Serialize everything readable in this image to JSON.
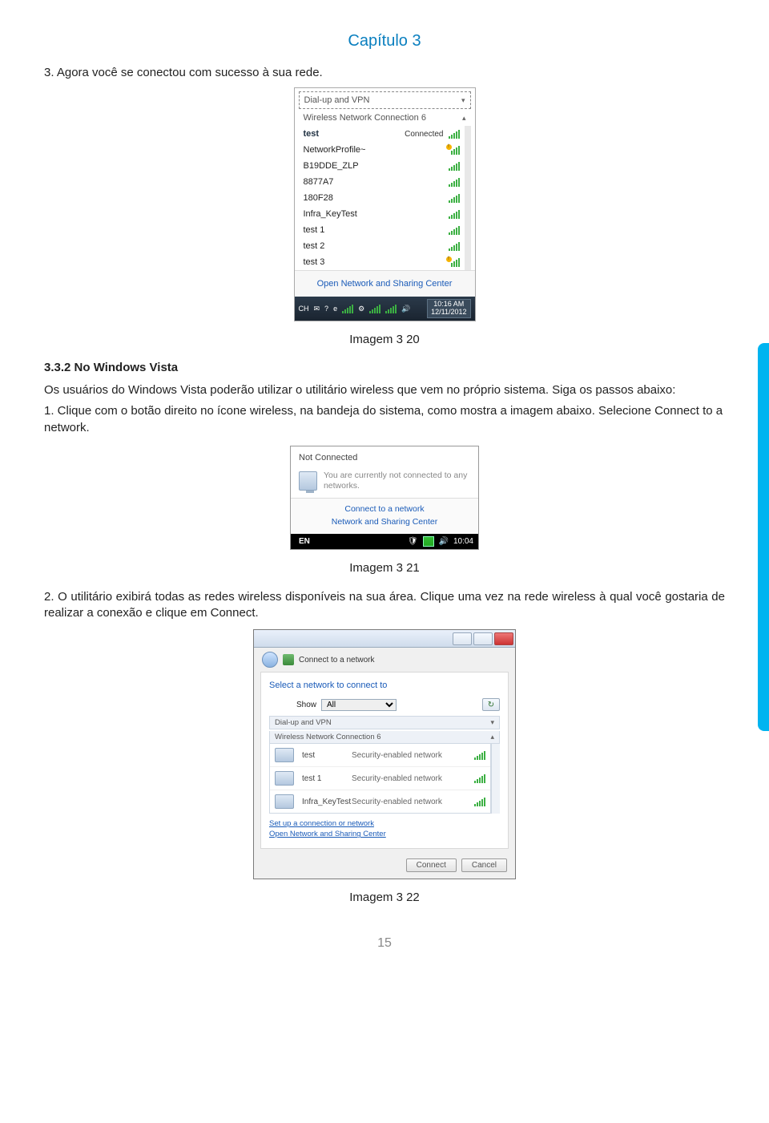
{
  "chapter_title": "Capítulo 3",
  "intro_line": "3. Agora você se conectou com sucesso à sua rede.",
  "ss1": {
    "dialup": "Dial-up and VPN",
    "wnc": "Wireless Network Connection 6",
    "networks": [
      {
        "name": "test",
        "status": "Connected"
      },
      {
        "name": "NetworkProfile~",
        "status": ""
      },
      {
        "name": "B19DDE_ZLP",
        "status": ""
      },
      {
        "name": "8877A7",
        "status": ""
      },
      {
        "name": "180F28",
        "status": ""
      },
      {
        "name": "Infra_KeyTest",
        "status": ""
      },
      {
        "name": "test 1",
        "status": ""
      },
      {
        "name": "test 2",
        "status": ""
      },
      {
        "name": "test 3",
        "status": ""
      }
    ],
    "footer": "Open Network and Sharing Center",
    "tb_ch": "CH",
    "tb_time": "10:16 AM",
    "tb_date": "12/11/2012"
  },
  "caption1": "Imagem 3 20",
  "section_head": "3.3.2 No Windows Vista",
  "para1": "Os usuários do Windows Vista poderão utilizar o utilitário wireless que vem no próprio sistema. Siga os passos abaixo:",
  "para2": "1. Clique com o botão direito no ícone wireless, na bandeja do sistema, como mostra a imagem abaixo. Selecione Connect to a network.",
  "ss2": {
    "nc": "Not Connected",
    "msg": "You are currently not connected to any networks.",
    "link1": "Connect to a network",
    "link2": "Network and Sharing Center",
    "lang": "EN",
    "time": "10:04"
  },
  "caption2": "Imagem 3 21",
  "para3": "2. O utilitário exibirá todas as redes wireless disponíveis na sua área. Clique uma vez na rede wireless à qual você gostaria de realizar a conexão e clique em Connect.",
  "ss3": {
    "hdr": "Connect to a network",
    "sel": "Select a network to connect to",
    "show_lbl": "Show",
    "show_val": "All",
    "group1": "Dial-up and VPN",
    "group2": "Wireless Network Connection 6",
    "rows": [
      {
        "name": "test",
        "sec": "Security-enabled network"
      },
      {
        "name": "test 1",
        "sec": "Security-enabled network"
      },
      {
        "name": "Infra_KeyTest",
        "sec": "Security-enabled network"
      }
    ],
    "lnk1": "Set up a connection or network",
    "lnk2": "Open Network and Sharing Center",
    "btn_connect": "Connect",
    "btn_cancel": "Cancel"
  },
  "caption3": "Imagem 3 22",
  "page_number": "15"
}
